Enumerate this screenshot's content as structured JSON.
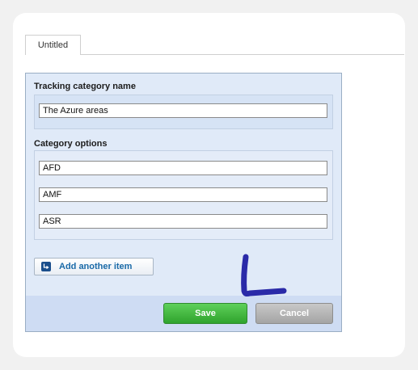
{
  "tab": {
    "label": "Untitled"
  },
  "form": {
    "name_label": "Tracking category name",
    "name_value": "The Azure areas",
    "options_label": "Category options",
    "options": [
      "AFD",
      "AMF",
      "ASR"
    ],
    "add_label": "Add another item",
    "save_label": "Save",
    "cancel_label": "Cancel"
  },
  "colors": {
    "panel": "#e0eaf8",
    "save": "#3fb83c",
    "cancel": "#a9a9a9",
    "link": "#1a6aa8",
    "annotation": "#2a2aa8"
  },
  "icons": {
    "add": "add-item-arrow-icon"
  }
}
